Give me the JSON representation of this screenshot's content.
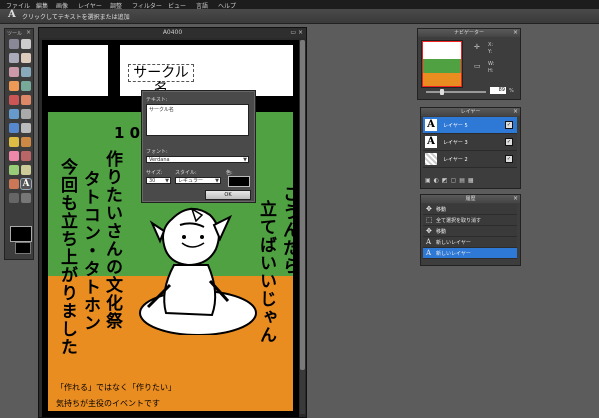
{
  "menu": {
    "items": [
      "ファイル",
      "編集",
      "画像",
      "レイヤー",
      "調整",
      "フィルター",
      "ビュー",
      "言語",
      "ヘルプ"
    ]
  },
  "options_bar": {
    "tool_icon": "A",
    "hint": "クリックしてテキストを選択または追加"
  },
  "tools_panel": {
    "title": "ツール",
    "close": "×",
    "text_tool": "A"
  },
  "document": {
    "title": "A0400",
    "controls": "▭ ×",
    "circle_name": "サークル名",
    "date_prefix": "1 0",
    "col1": "こうんだら",
    "col2": "立てばいいじゃん",
    "col3": "作りたいさんの文化祭",
    "col4": "タトコン・タトホン",
    "col5": "今回も立ち上がりました",
    "caption1": "「作れる」ではなく「作りたい」",
    "caption2": "気持ちが主役のイベントです"
  },
  "text_dialog": {
    "text_label": "テキスト:",
    "text_value": "サークル名",
    "font_label": "フォント:",
    "font_value": "Verdana",
    "size_label": "サイズ:",
    "size_value": "30",
    "style_label": "スタイル:",
    "style_value": "レギュラー",
    "color_label": "色:",
    "color_value": "#000000",
    "ok_label": "OK"
  },
  "navigator": {
    "title": "ナビゲーター",
    "x_label": "X:",
    "y_label": "Y:",
    "w_label": "W:",
    "h_label": "H:",
    "zoom": "89",
    "zoom_unit": "%"
  },
  "layers": {
    "title": "レイヤー",
    "items": [
      {
        "name": "レイヤー 5",
        "thumb": "A"
      },
      {
        "name": "レイヤー 3",
        "thumb": "A"
      },
      {
        "name": "レイヤー 2",
        "thumb": ""
      }
    ]
  },
  "history": {
    "title": "履歴",
    "items": [
      {
        "icon": "✥",
        "label": "移動"
      },
      {
        "icon": "⬚",
        "label": "全て選択を取り消す"
      },
      {
        "icon": "✥",
        "label": "移動"
      },
      {
        "icon": "A",
        "label": "新しいレイヤー"
      },
      {
        "icon": "A",
        "label": "新しいレイヤー"
      }
    ]
  },
  "colors": {
    "accent": "#2f79d6",
    "green": "#4fa142",
    "orange": "#ea8d20",
    "ui_dark": "#3d3d3d"
  }
}
